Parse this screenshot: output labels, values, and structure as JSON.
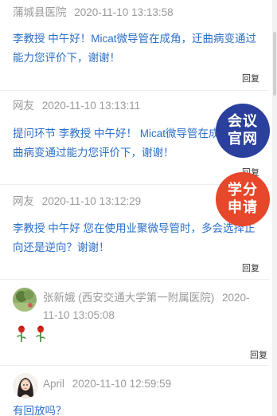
{
  "comments": [
    {
      "name": "蒲城县医院",
      "time": "2020-11-10 13:13:58",
      "text": "李教授 中午好！Micat微导管在成角，迂曲病变通过能力您评价下，谢谢！",
      "reply_label": "回复"
    },
    {
      "name": "网友",
      "time": "2020-11-10 13:13:11",
      "text": "提问环节 李教授 中午好！ Micat微导管在成角，迂曲病变通过能力您评价下，谢谢！",
      "reply_label": "回复"
    },
    {
      "name": "网友",
      "time": "2020-11-10 13:12:29",
      "text": "李教授 中午好 您在使用业聚微导管时，多会选择正向还是逆向？谢谢！",
      "reply_label": "回复"
    },
    {
      "name": "张新娥 (西安交通大学第一附属医院)",
      "time": "2020-11-10 13:05:08",
      "text": "",
      "reply_label": "回复"
    },
    {
      "name": "April",
      "time": "2020-11-10 12:59:59",
      "text": "有回放吗？"
    }
  ],
  "badges": {
    "conference": "会议官网",
    "credit": "学分申请"
  },
  "icons": {
    "flower": "rose-icon",
    "avatar_4": "landscape-avatar",
    "avatar_5": "cartoon-girl-avatar"
  },
  "colors": {
    "link_text": "#2c6fc8",
    "meta_text": "#9a9a9a",
    "badge_blue": "#2b3f9c",
    "badge_red": "#e7472a"
  }
}
